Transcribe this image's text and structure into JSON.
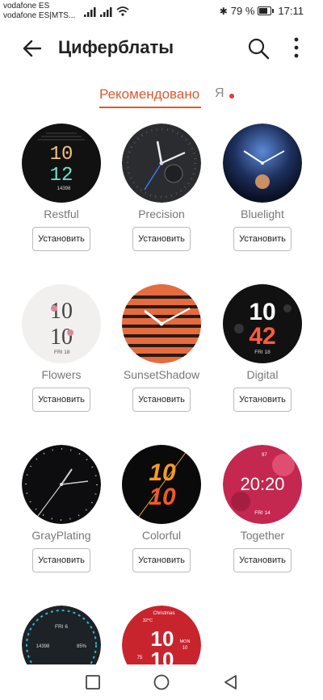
{
  "status": {
    "carrier1": "vodafone ES",
    "carrier2": "vodafone ES|MTS...",
    "battery_text": "79 %",
    "battery_level": 0.79,
    "time": "17:11"
  },
  "appbar": {
    "title": "Циферблаты",
    "back_icon": "arrow-left-icon",
    "search_icon": "search-icon",
    "more_icon": "more-vertical-icon"
  },
  "tabs": {
    "recommended": "Рекомендовано",
    "mine": "Я"
  },
  "colors": {
    "accent": "#e0582f",
    "dot": "#e53935"
  },
  "faces": [
    {
      "name": "Restful",
      "button": "Установить",
      "line1": "10",
      "line2": "12",
      "extra": "14398"
    },
    {
      "name": "Precision",
      "button": "Установить"
    },
    {
      "name": "Bluelight",
      "button": "Установить"
    },
    {
      "name": "Flowers",
      "button": "Установить",
      "line1": "10",
      "line2": "10",
      "extra": "FRI 18"
    },
    {
      "name": "SunsetShadow",
      "button": "Установить"
    },
    {
      "name": "Digital",
      "button": "Установить",
      "line1": "10",
      "line2": "42",
      "extra": "FRI 18"
    },
    {
      "name": "GrayPlating",
      "button": "Установить"
    },
    {
      "name": "Colorful",
      "button": "Установить",
      "line1": "10",
      "line2": "10"
    },
    {
      "name": "Together",
      "button": "Установить",
      "time": "20:20",
      "extra": "FRI 14",
      "hr": "97"
    },
    {
      "name": "",
      "button": "",
      "extra": "FRI 6",
      "left": "14398",
      "right": "85%"
    },
    {
      "name": "",
      "button": "",
      "line1": "10",
      "line2": "10",
      "extra": "Christmas",
      "temp": "32°C",
      "day": "MON",
      "date": "10",
      "steps": "75"
    }
  ]
}
